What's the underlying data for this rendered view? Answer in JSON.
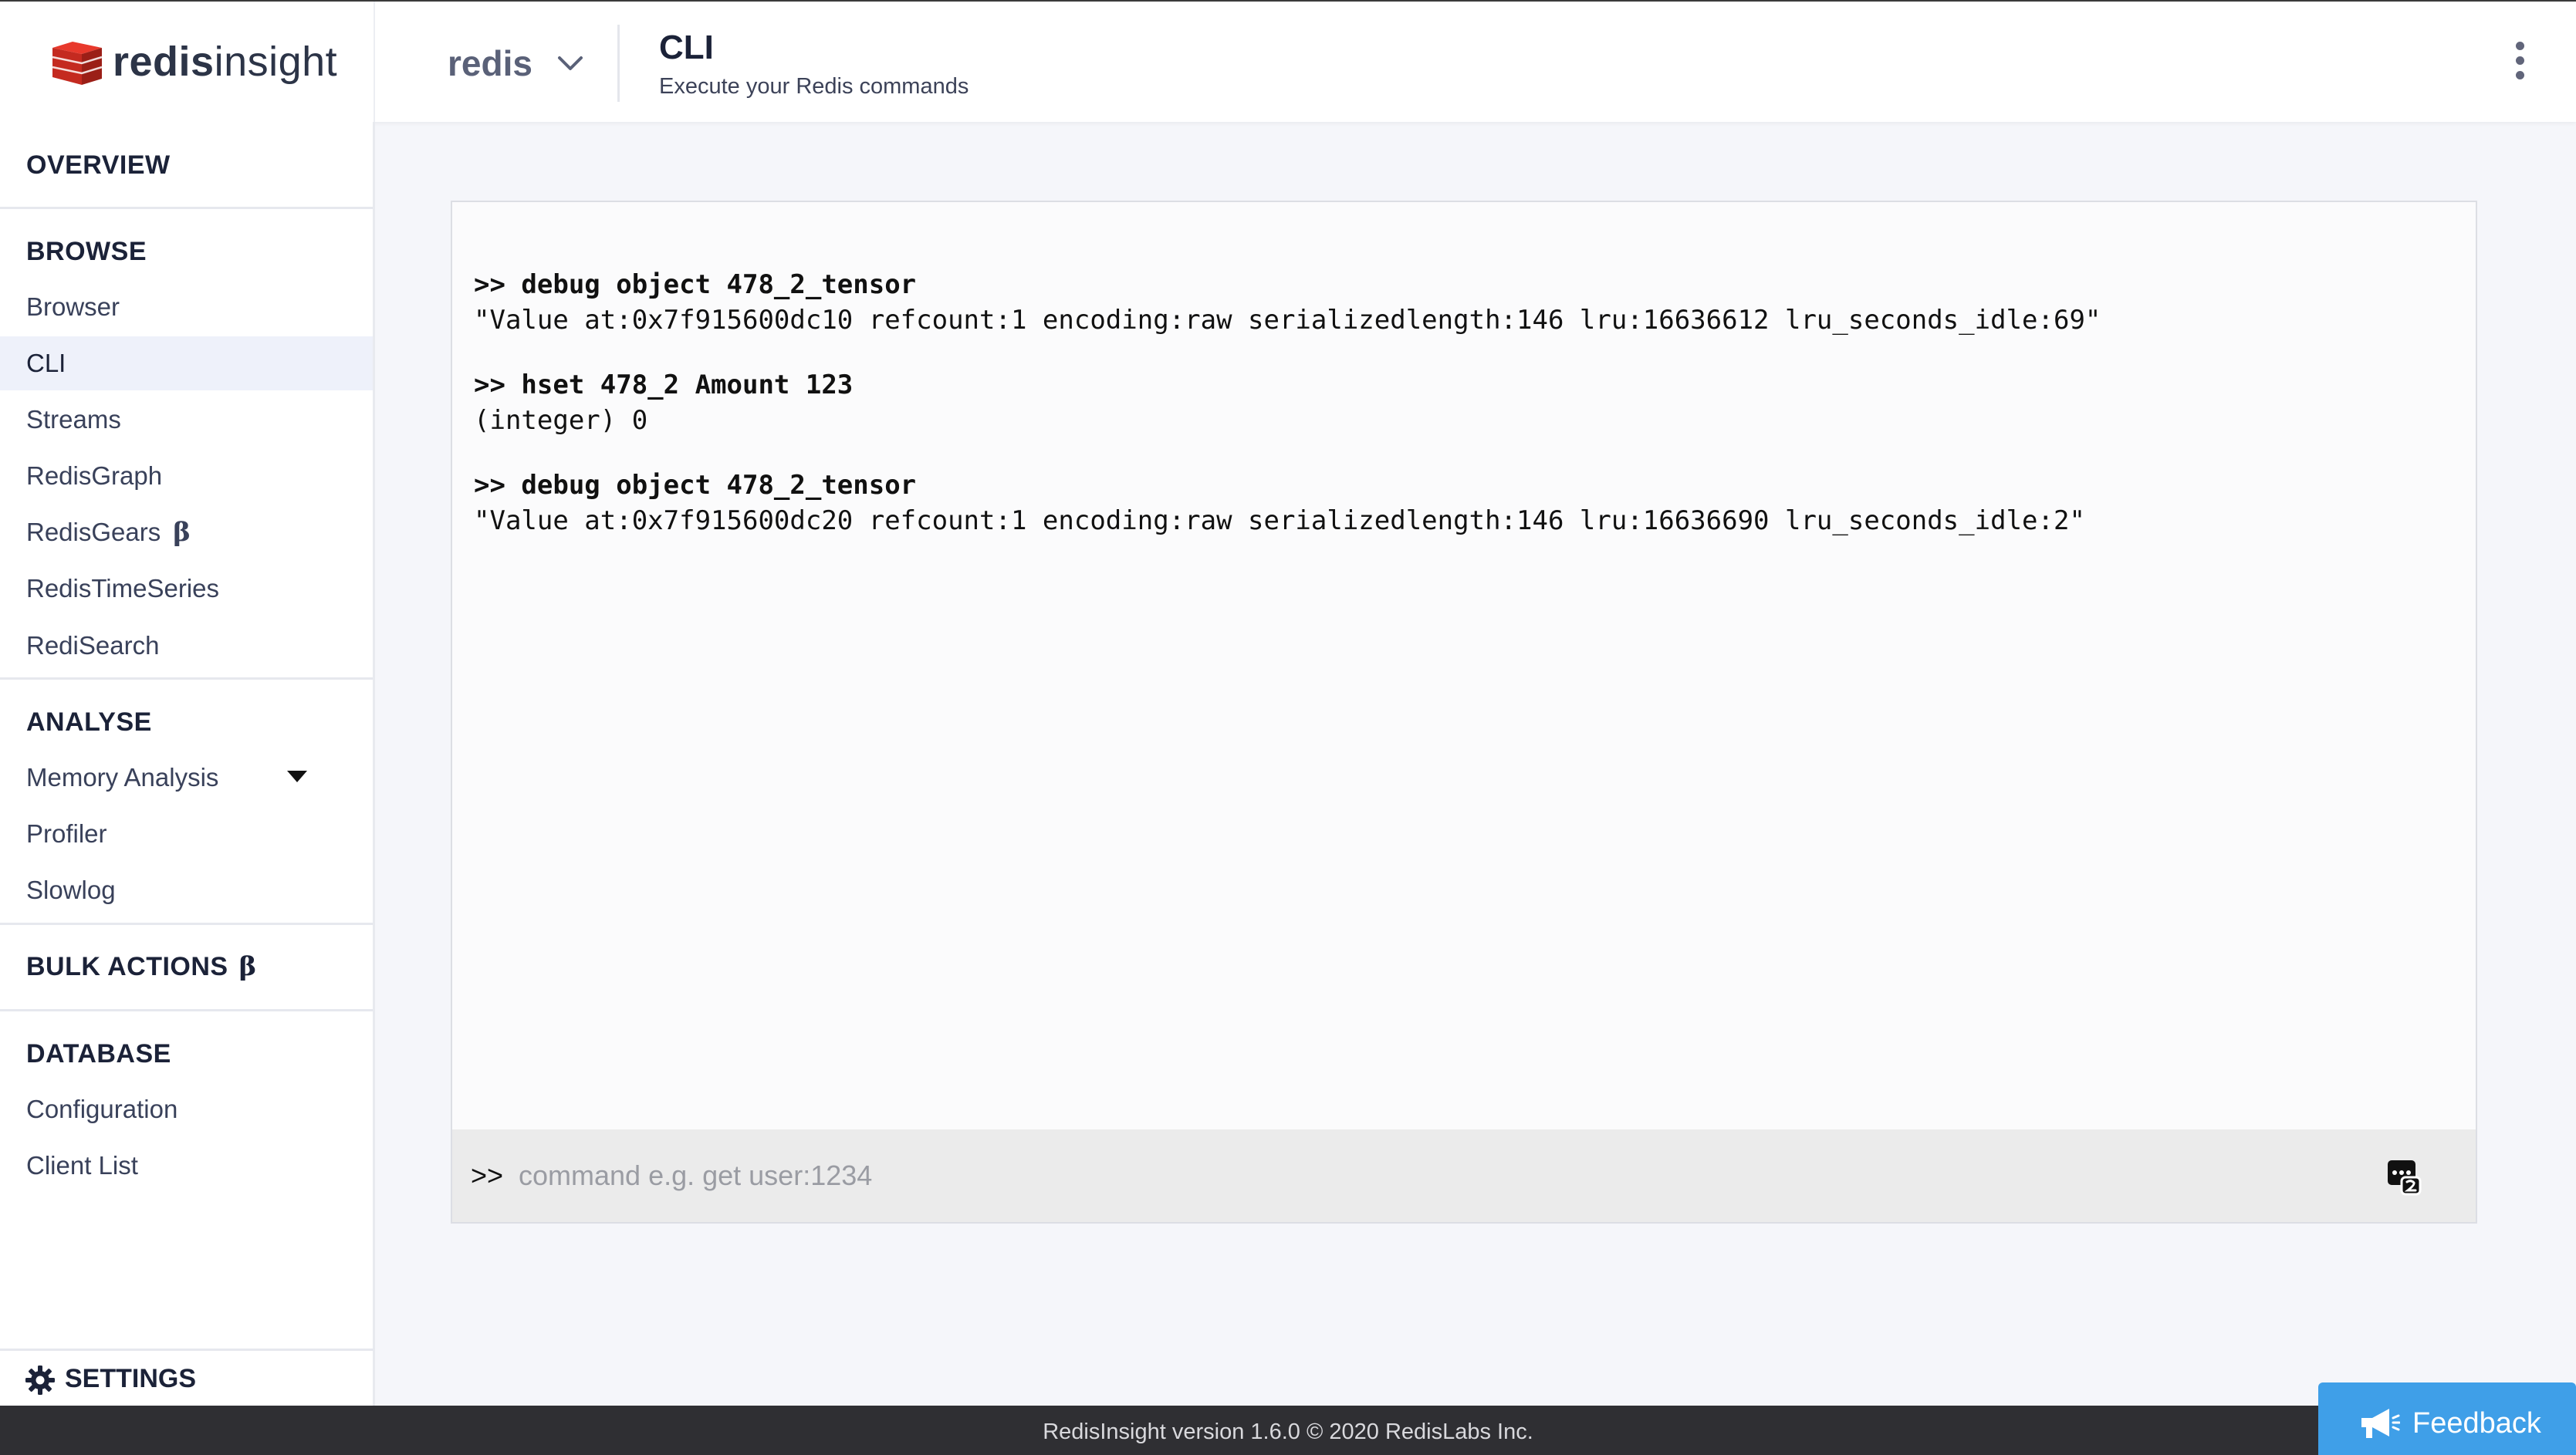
{
  "app": {
    "logo_part1": "redis",
    "logo_part2": "insight"
  },
  "header": {
    "database_name": "redis",
    "page_title": "CLI",
    "page_subtitle": "Execute your Redis commands"
  },
  "sidebar": {
    "overview": "OVERVIEW",
    "browse": {
      "title": "BROWSE",
      "items": [
        {
          "label": "Browser"
        },
        {
          "label": "CLI",
          "active": true
        },
        {
          "label": "Streams"
        },
        {
          "label": "RedisGraph"
        },
        {
          "label": "RedisGears",
          "badge": "β"
        },
        {
          "label": "RedisTimeSeries"
        },
        {
          "label": "RediSearch"
        }
      ]
    },
    "analyse": {
      "title": "ANALYSE",
      "items": [
        {
          "label": "Memory Analysis"
        },
        {
          "label": "Profiler"
        },
        {
          "label": "Slowlog"
        }
      ]
    },
    "bulk_actions": {
      "title": "BULK ACTIONS",
      "badge": "β"
    },
    "database": {
      "title": "DATABASE",
      "items": [
        {
          "label": "Configuration"
        },
        {
          "label": "Client List"
        }
      ]
    },
    "settings": "SETTINGS"
  },
  "cli": {
    "entries": [
      {
        "command": ">> debug object 478_2_tensor",
        "result": "\"Value at:0x7f915600dc10 refcount:1 encoding:raw serializedlength:146 lru:16636612 lru_seconds_idle:69\""
      },
      {
        "command": ">> hset 478_2 Amount 123",
        "result": "(integer) 0"
      },
      {
        "command": ">> debug object 478_2_tensor",
        "result": "\"Value at:0x7f915600dc20 refcount:1 encoding:raw serializedlength:146 lru:16636690 lru_seconds_idle:2\""
      }
    ],
    "prompt": ">>",
    "input_placeholder": "command e.g. get user:1234",
    "input_value": ""
  },
  "footer": {
    "version_text": "RedisInsight version 1.6.0 © 2020 RedisLabs Inc.",
    "feedback_label": "Feedback"
  },
  "colors": {
    "accent_red": "#d82c20",
    "feedback_blue": "#3f9fe8",
    "active_nav_bg": "#eef1fa"
  }
}
